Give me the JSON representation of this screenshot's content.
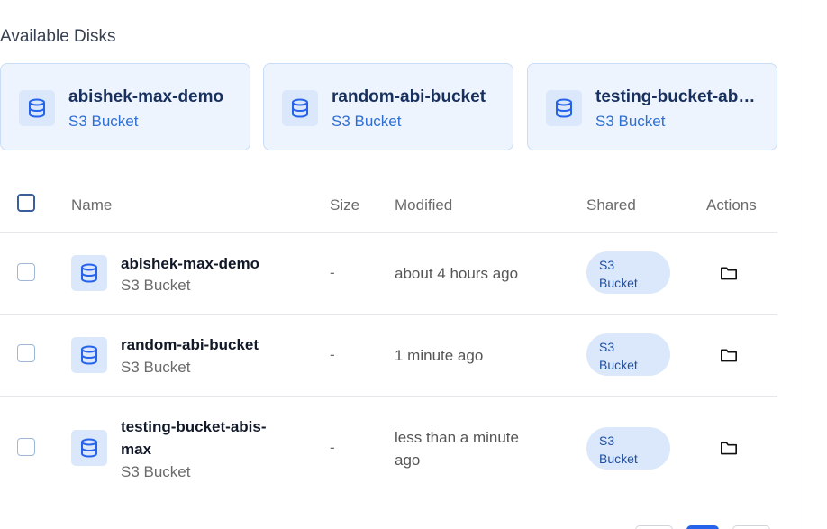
{
  "section": {
    "title": "Available Disks"
  },
  "disks": [
    {
      "name": "abishek-max-demo",
      "type": "S3 Bucket"
    },
    {
      "name": "random-abi-bucket",
      "type": "S3 Bucket"
    },
    {
      "name": "testing-bucket-abis-max",
      "type": "S3 Bucket"
    }
  ],
  "table": {
    "columns": {
      "name": "Name",
      "size": "Size",
      "modified": "Modified",
      "shared": "Shared",
      "actions": "Actions"
    },
    "rows": [
      {
        "name": "abishek-max-demo",
        "type": "S3 Bucket",
        "size": "-",
        "modified": "about 4 hours ago",
        "shared_line1": "S3",
        "shared_line2": "Bucket"
      },
      {
        "name": "random-abi-bucket",
        "type": "S3 Bucket",
        "size": "-",
        "modified": "1 minute ago",
        "shared_line1": "S3",
        "shared_line2": "Bucket"
      },
      {
        "name": "testing-bucket-abis-max",
        "type": "S3 Bucket",
        "size": "-",
        "modified": "less than a minute ago",
        "shared_line1": "S3",
        "shared_line2": "Bucket"
      }
    ]
  },
  "icons": {
    "disk": "database-icon",
    "row": "database-icon",
    "action": "folder-icon"
  },
  "colors": {
    "accent": "#2f6fd3",
    "card_bg": "#eef4fe",
    "badge_bg": "#dbe7fb"
  }
}
